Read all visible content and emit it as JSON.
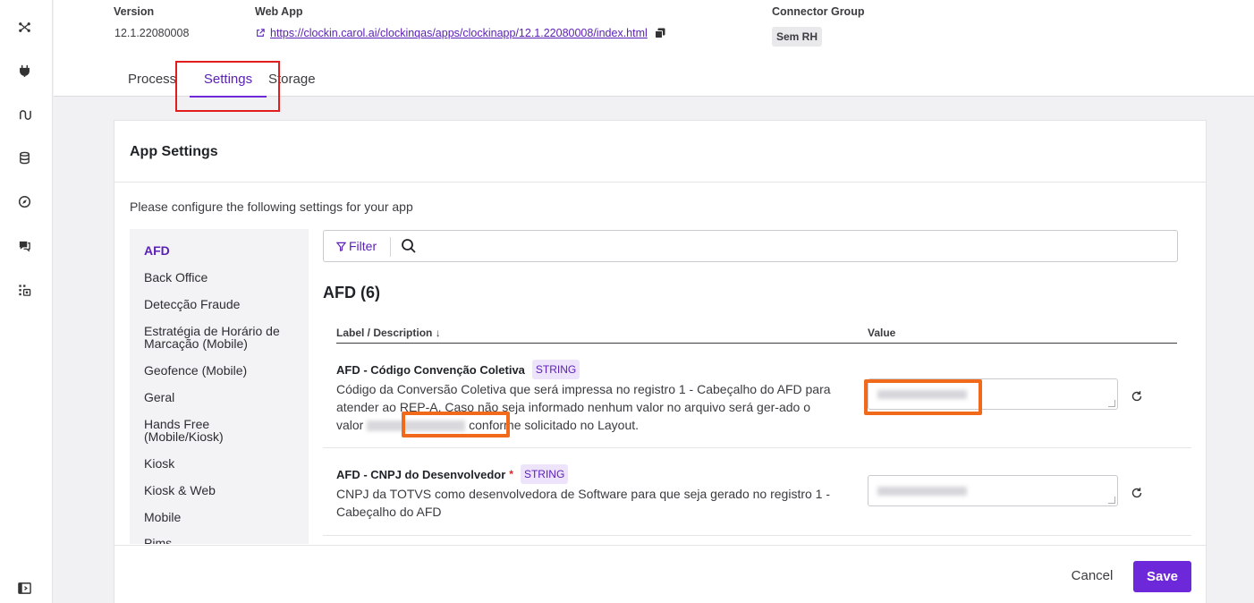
{
  "header": {
    "version_label": "Version",
    "version_value": "12.1.22080008",
    "webapp_label": "Web App",
    "webapp_url": "https://clockin.carol.ai/clockinqas/apps/clockinapp/12.1.22080008/index.html",
    "connector_label": "Connector Group",
    "connector_value": "Sem RH"
  },
  "tabs": [
    {
      "label": "Process",
      "active": false
    },
    {
      "label": "Settings",
      "active": true
    },
    {
      "label": "Storage",
      "active": false
    }
  ],
  "rail_icons": [
    "flow-icon",
    "plug-icon",
    "route-icon",
    "database-icon",
    "compass-icon",
    "chat-icon",
    "apps-icon",
    "expand-sidebar-icon"
  ],
  "card": {
    "title": "App Settings",
    "intro": "Please configure the following settings for your app"
  },
  "categories": [
    "AFD",
    "Back Office",
    "Detecção Fraude",
    "Estratégia de Horário de Marcação (Mobile)",
    "Geofence (Mobile)",
    "Geral",
    "Hands Free (Mobile/Kiosk)",
    "Kiosk",
    "Kiosk & Web",
    "Mobile",
    "Pims"
  ],
  "active_category": "AFD",
  "search": {
    "filter_label": "Filter"
  },
  "section_title": "AFD (6)",
  "columns": {
    "label": "Label / Description ↓",
    "value": "Value"
  },
  "settings": [
    {
      "name": "AFD - Código Convenção Coletiva",
      "required": false,
      "type": "STRING",
      "desc_before": "Código da Conversão Coletiva que será impressa no registro 1 - Cabeçalho do AFD para atender ao REP-A. Caso não seja informado nenhum valor no arquivo será ger-ado o valor",
      "desc_after": "conforme solicitado no Layout."
    },
    {
      "name": "AFD - CNPJ do Desenvolvedor",
      "required": true,
      "required_mark": "*",
      "type": "STRING",
      "desc_before": "CNPJ da TOTVS como desenvolvedora de Software para que seja gerado no registro 1 - Cabeçalho do AFD",
      "desc_after": ""
    }
  ],
  "footer": {
    "cancel_label": "Cancel",
    "save_label": "Save"
  },
  "colors": {
    "accent": "#6d28d9",
    "highlight_red": "#e11d1d",
    "highlight_orange": "#f16a1c"
  }
}
